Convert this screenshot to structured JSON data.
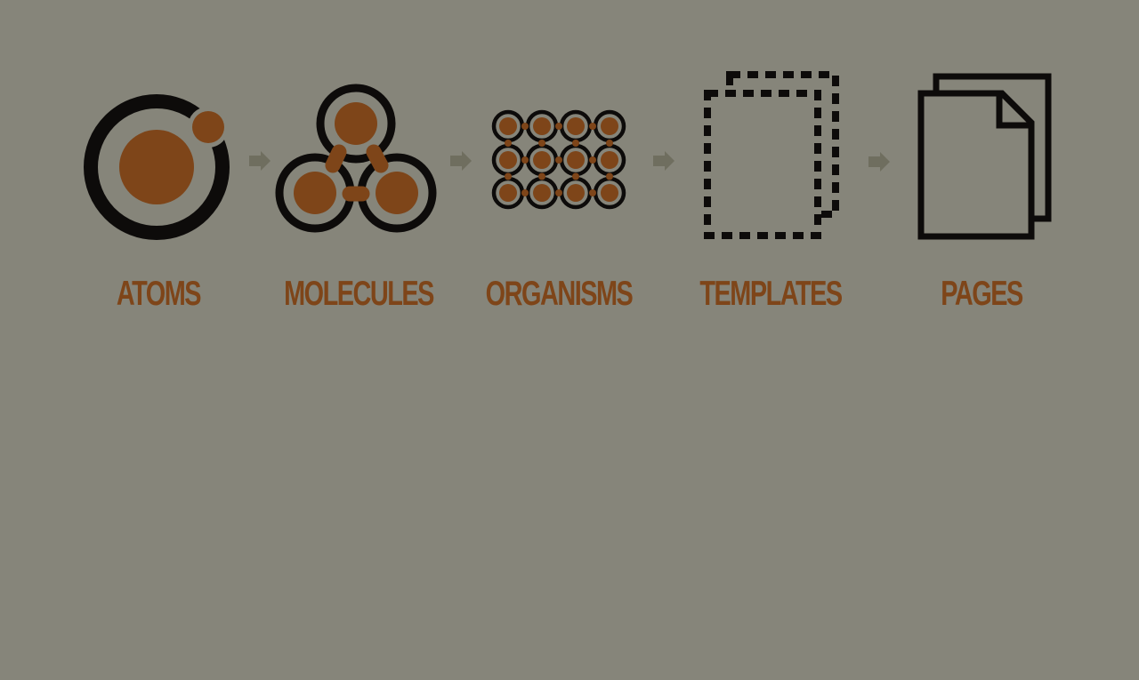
{
  "stages": [
    {
      "id": "atoms",
      "label": "ATOMS",
      "icon": "atom-icon"
    },
    {
      "id": "molecules",
      "label": "MOLECULES",
      "icon": "molecule-icon"
    },
    {
      "id": "organisms",
      "label": "ORGANISMS",
      "icon": "organism-grid-icon"
    },
    {
      "id": "templates",
      "label": "TEMPLATES",
      "icon": "dashed-template-icon"
    },
    {
      "id": "pages",
      "label": "PAGES",
      "icon": "pages-icon"
    }
  ],
  "colors": {
    "background": "#86857a",
    "accent": "#7e4519",
    "stroke": "#0d0b0a",
    "arrow": "#6f6e5f"
  }
}
